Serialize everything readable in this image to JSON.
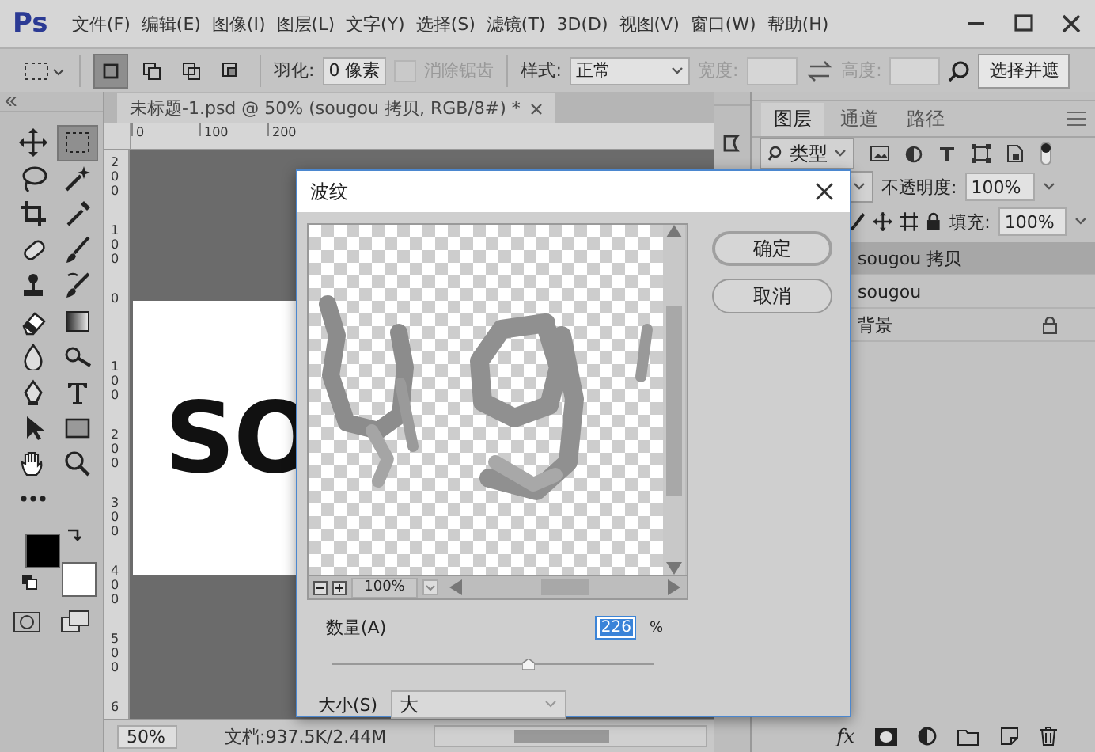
{
  "app": {
    "logo": "Ps"
  },
  "menu": [
    "文件(F)",
    "编辑(E)",
    "图像(I)",
    "图层(L)",
    "文字(Y)",
    "选择(S)",
    "滤镜(T)",
    "3D(D)",
    "视图(V)",
    "窗口(W)",
    "帮助(H)"
  ],
  "options_bar": {
    "modes": [
      {
        "selected": true
      },
      {
        "selected": false
      },
      {
        "selected": false
      },
      {
        "selected": false
      }
    ],
    "feather_label": "羽化:",
    "feather_value": "0 像素",
    "antialias": {
      "label": "消除锯齿",
      "checked": false,
      "disabled": true
    },
    "style_label": "样式:",
    "style_value": "正常",
    "width_label": "宽度:",
    "height_label": "高度:",
    "select_mask_button": "选择并遮"
  },
  "toolbar": {
    "tools": [
      {
        "kind": "move",
        "selected": false
      },
      {
        "kind": "marquee",
        "selected": true
      },
      {
        "kind": "lasso",
        "selected": false
      },
      {
        "kind": "wand",
        "selected": false
      },
      {
        "kind": "crop",
        "selected": false
      },
      {
        "kind": "eyedropper",
        "selected": false
      },
      {
        "kind": "healing",
        "selected": false
      },
      {
        "kind": "brush",
        "selected": false
      },
      {
        "kind": "stamp",
        "selected": false
      },
      {
        "kind": "history",
        "selected": false
      },
      {
        "kind": "eraser",
        "selected": false
      },
      {
        "kind": "gradient",
        "selected": false
      },
      {
        "kind": "blur",
        "selected": false
      },
      {
        "kind": "dodge",
        "selected": false
      },
      {
        "kind": "pen",
        "selected": false
      },
      {
        "kind": "type",
        "selected": false
      },
      {
        "kind": "arrow",
        "selected": false
      },
      {
        "kind": "rectangle",
        "selected": false
      },
      {
        "kind": "hand",
        "selected": false
      },
      {
        "kind": "zoom",
        "selected": false
      },
      {
        "kind": "more",
        "selected": false
      }
    ],
    "swatches": [
      {
        "kind": "foreground",
        "color": "#000000"
      },
      {
        "kind": "background",
        "color": "#ffffff"
      }
    ]
  },
  "document": {
    "tab_title": "未标题-1.psd @ 50% (sougou 拷贝, RGB/8#) *",
    "ruler_h": [
      "0",
      "100",
      "200"
    ],
    "ruler_v": [
      "200",
      "100",
      "0",
      "100",
      "200",
      "300",
      "400",
      "500",
      "6"
    ],
    "canvas_text": "SO"
  },
  "layers_panel": {
    "tabs": [
      {
        "label": "图层",
        "selected": true
      },
      {
        "label": "通道",
        "selected": false
      },
      {
        "label": "路径",
        "selected": false
      }
    ],
    "filter_label": "类型",
    "opacity_label": "不透明度:",
    "opacity_value": "100%",
    "fill_label": "填充:",
    "fill_value": "100%",
    "layers": [
      {
        "name": "sougou 拷贝",
        "selected": true,
        "locked": false
      },
      {
        "name": "sougou",
        "selected": false,
        "locked": false
      },
      {
        "name": "背景",
        "selected": false,
        "locked": true
      }
    ],
    "fx_label": "fx"
  },
  "dialog": {
    "title": "波纹",
    "zoom_value": "100%",
    "buttons": [
      {
        "label": "确定",
        "kind": "default"
      },
      {
        "label": "取消",
        "kind": "normal"
      }
    ],
    "amount_label": "数量(A)",
    "amount_value": "226",
    "amount_unit": "%",
    "amount_slider": {
      "level": 0.61
    },
    "size_label": "大小(S)",
    "size_value": "大"
  },
  "status_bar": {
    "zoom": "50%",
    "doc_info": "文档:937.5K/2.44M"
  }
}
